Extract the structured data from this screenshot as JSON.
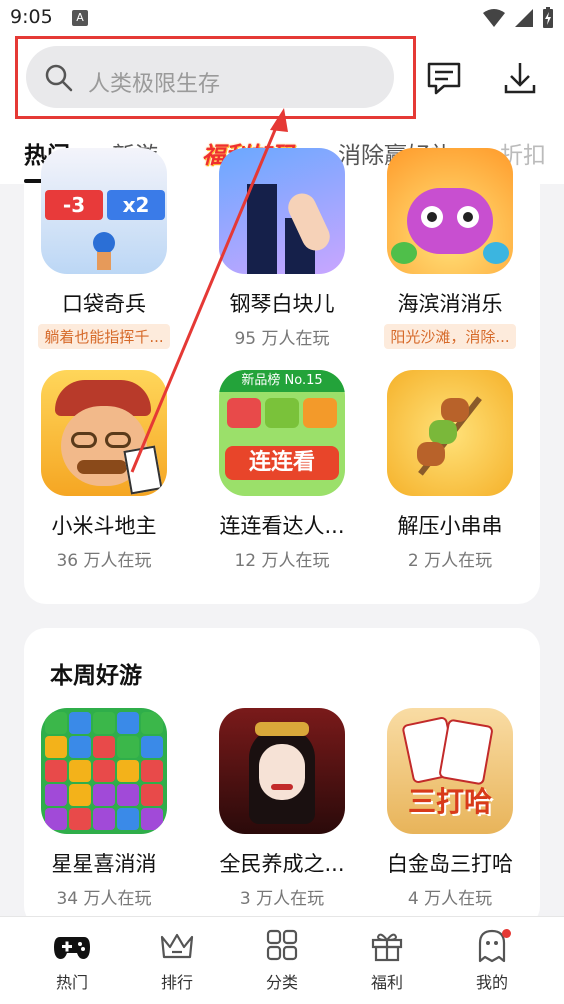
{
  "status_bar": {
    "time": "9:05",
    "notif_badge": "A"
  },
  "search": {
    "placeholder": "人类极限生存"
  },
  "tabs": [
    {
      "label": "热门"
    },
    {
      "label": "新游"
    },
    {
      "label": "福利加码"
    },
    {
      "label": "消除赢好礼"
    },
    {
      "label": "折扣"
    }
  ],
  "hot_apps": [
    {
      "name": "口袋奇兵",
      "tag": "躺着也能指挥千..."
    },
    {
      "name": "钢琴白块儿",
      "players": "95 万人在玩"
    },
    {
      "name": "海滨消消乐",
      "tag": "阳光沙滩，消除..."
    },
    {
      "name": "小米斗地主",
      "players": "36 万人在玩"
    },
    {
      "name": "连连看达人...",
      "players": "12 万人在玩",
      "badge": "新品榜 No.15",
      "icon_text": "连连看"
    },
    {
      "name": "解压小串串",
      "players": "2 万人在玩"
    }
  ],
  "weekly": {
    "title": "本周好游",
    "apps": [
      {
        "name": "星星喜消消",
        "players": "34 万人在玩"
      },
      {
        "name": "全民养成之...",
        "players": "3 万人在玩"
      },
      {
        "name": "白金岛三打哈",
        "players": "4 万人在玩",
        "icon_text": "三打哈"
      }
    ]
  },
  "bottom_nav": [
    {
      "label": "热门",
      "icon": "gamepad-icon"
    },
    {
      "label": "排行",
      "icon": "crown-icon"
    },
    {
      "label": "分类",
      "icon": "grid-icon"
    },
    {
      "label": "福利",
      "icon": "gift-icon"
    },
    {
      "label": "我的",
      "icon": "ghost-icon"
    }
  ],
  "colors": {
    "accent_red": "#e53935",
    "tag_orange": "#d66a2a"
  }
}
